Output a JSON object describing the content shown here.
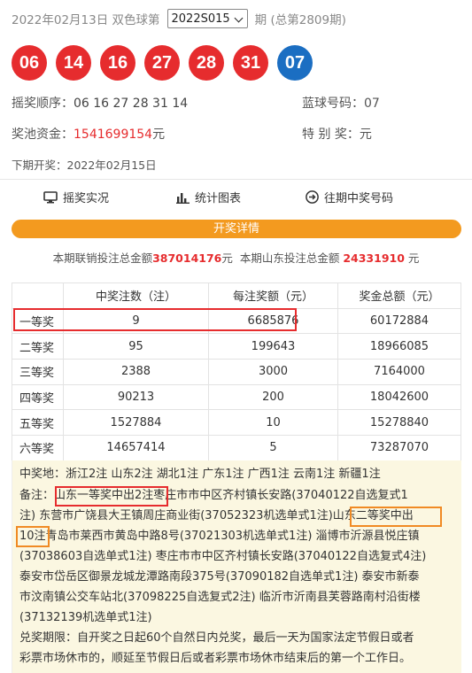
{
  "header": {
    "date_label": "2022年02月13日 双色球第",
    "issue_selected": "2022S015",
    "suffix": "期 (总第2809期)"
  },
  "balls": {
    "red": [
      "06",
      "14",
      "16",
      "27",
      "28",
      "31"
    ],
    "blue": "07"
  },
  "info": {
    "order_label": "摇奖顺序：",
    "order_value": "06 16 27 28 31 14",
    "blue_label": "蓝球号码：",
    "blue_value": "07",
    "pool_label": "奖池资金：",
    "pool_value": "1541699154",
    "pool_unit": "元",
    "special_label": "特 别 奖：",
    "special_value": "元",
    "next_open": "下期开奖：2022年02月15日"
  },
  "links": {
    "live": "摇奖实况",
    "chart": "统计图表",
    "history": "往期中奖号码"
  },
  "detail_bar": "开奖详情",
  "totals": {
    "national_label": "本期联销投注总金额",
    "national_value": "387014176",
    "unit": "元",
    "shandong_label": "本期山东投注总金额",
    "shandong_value": "24331910"
  },
  "table": {
    "headers": [
      "",
      "中奖注数（注）",
      "每注奖额（元）",
      "奖金总额（元）"
    ],
    "rows": [
      [
        "一等奖",
        "9",
        "6685876",
        "60172884"
      ],
      [
        "二等奖",
        "95",
        "199643",
        "18966085"
      ],
      [
        "三等奖",
        "2388",
        "3000",
        "7164000"
      ],
      [
        "四等奖",
        "90213",
        "200",
        "18042600"
      ],
      [
        "五等奖",
        "1527884",
        "10",
        "15278840"
      ],
      [
        "六等奖",
        "14657414",
        "5",
        "73287070"
      ]
    ]
  },
  "winners": {
    "l1": "中奖地：浙江2注 山东2注 湖北1注 广东1注 广西1注 云南1注 新疆1注",
    "l2a": "备注：",
    "l2b": "山东一等奖中出2注",
    "l2c": "枣庄市市中区齐村镇长安路(37040122自选复式1",
    "l3a": "注) 东营市广饶县大王镇周庄商业街(37052323机选单式1注)",
    "l3b": "山东二等奖中出",
    "l4a": "10注",
    "l4b": "青岛市莱西市黄岛中路8号(37021303机选单式1注) 淄博市沂源县悦庄镇",
    "l5": "(37038603自选单式1注) 枣庄市市中区齐村镇长安路(37040122自选复式4注)",
    "l6": "泰安市岱岳区御景龙城龙潭路南段375号(37090182自选单式1注) 泰安市新泰",
    "l7": "市汶南镇公交车站北(37098225自选复式2注) 临沂市沂南县芙蓉路南村沿街楼",
    "l8": "(37132139机选单式1注)",
    "l9": "兑奖期限：自开奖之日起60个自然日内兑奖，最后一天为国家法定节假日或者",
    "l10": "彩票市场休市的，顺延至节假日后或者彩票市场休市结束后的第一个工作日。"
  }
}
